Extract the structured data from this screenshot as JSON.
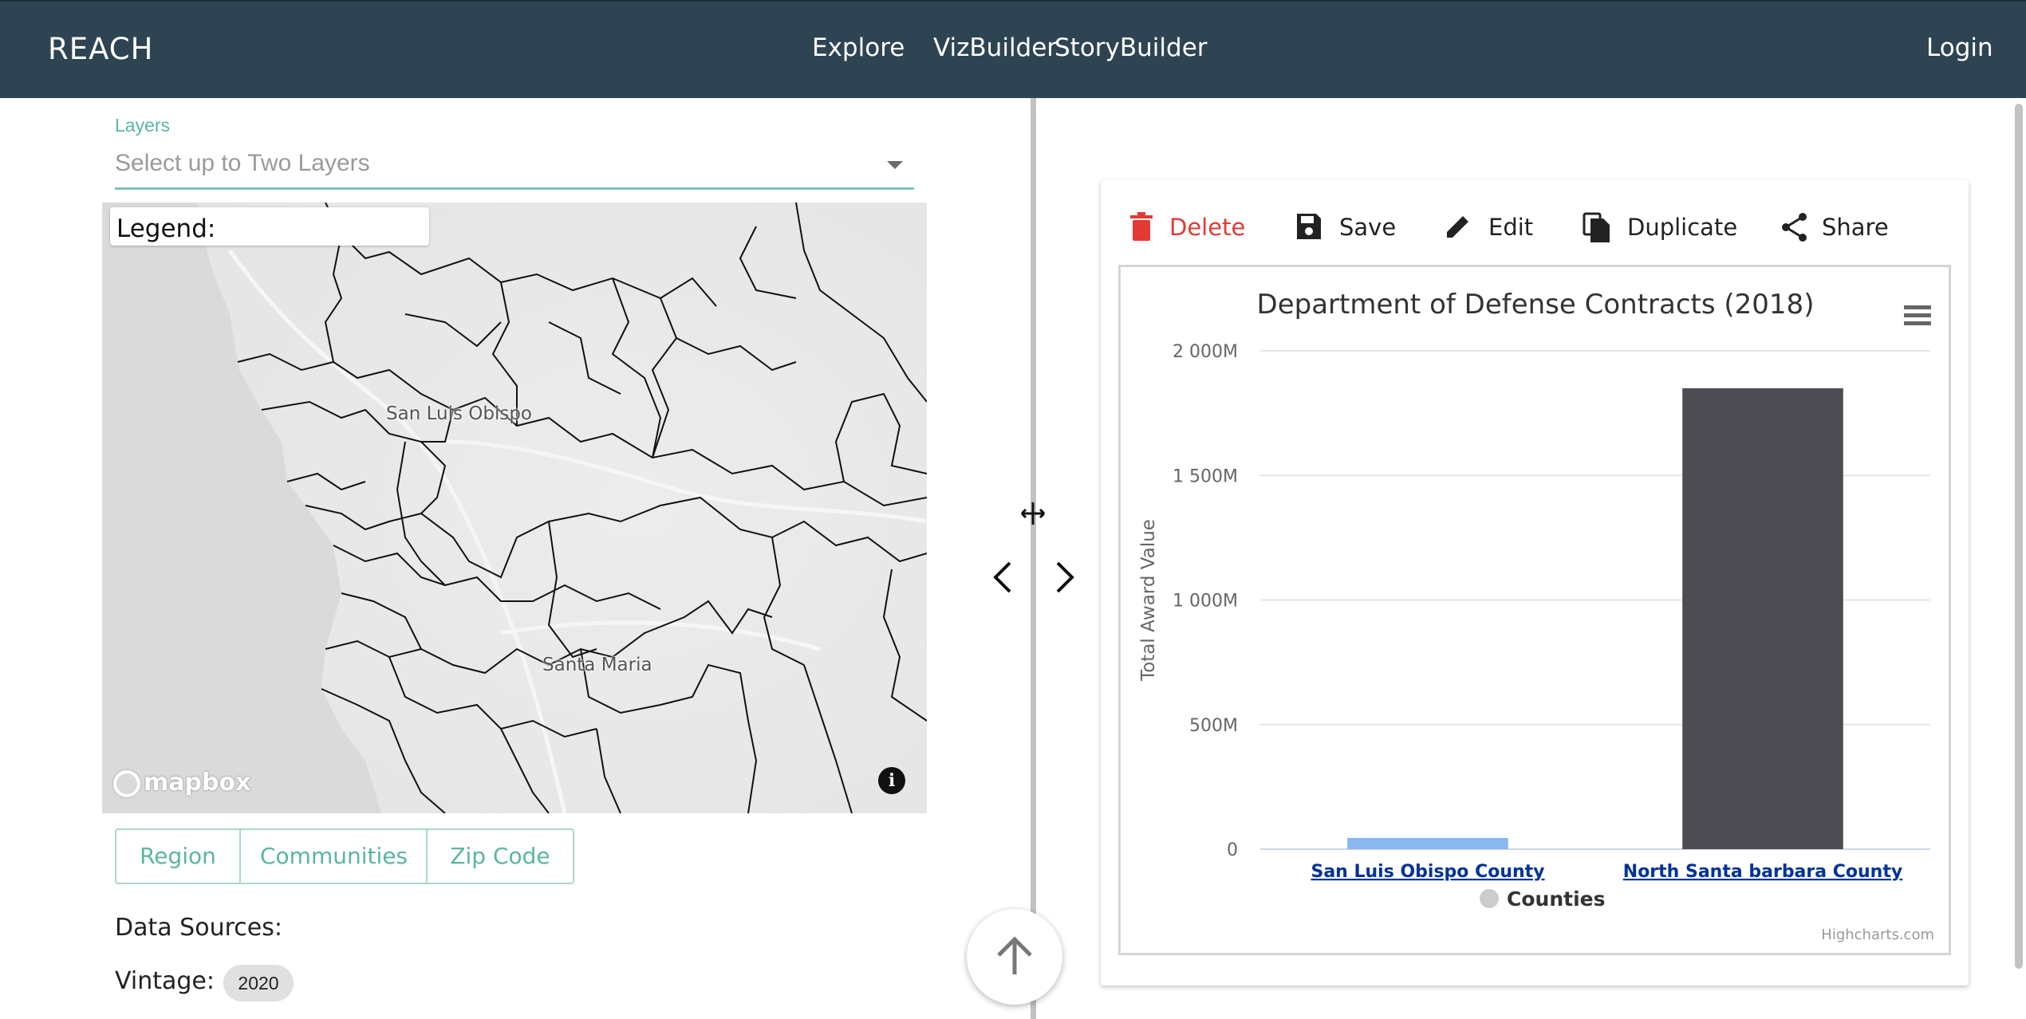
{
  "header": {
    "logo": "REACH",
    "nav": {
      "explore": "Explore",
      "vizbuilder": "VizBuilder",
      "storybuilder": "StoryBuilder",
      "login": "Login"
    },
    "background_color": "#2e4453"
  },
  "left_panel": {
    "layers_label": "Layers",
    "layers_placeholder": "Select up to Two Layers",
    "map": {
      "legend_label": "Legend:",
      "places": [
        "San Luis Obispo",
        "Santa Maria"
      ],
      "attribution": "mapbox",
      "info_icon": "info-icon"
    },
    "tabs": [
      "Region",
      "Communities",
      "Zip Code"
    ],
    "data_sources_label": "Data Sources:",
    "vintage_label": "Vintage:",
    "vintage_value": "2020",
    "accent_color": "#5bb5a2"
  },
  "toolbar": {
    "delete": "Delete",
    "save": "Save",
    "edit": "Edit",
    "duplicate": "Duplicate",
    "share": "Share",
    "delete_color": "#e53935"
  },
  "chart_data": {
    "type": "bar",
    "title": "Department of Defense Contracts (2018)",
    "ylabel": "Total Award Value",
    "xlabel": "",
    "categories": [
      "San Luis Obispo County",
      "North Santa barbara County"
    ],
    "series": [
      {
        "name": "Counties",
        "values": [
          45000000,
          1850000000
        ],
        "colors": [
          "#8ab8ee",
          "#4d4c52"
        ]
      }
    ],
    "ylim": [
      0,
      2000000000
    ],
    "yticks": [
      0,
      500000000,
      1000000000,
      1500000000,
      2000000000
    ],
    "ytick_labels": [
      "0",
      "500M",
      "1 000M",
      "1 500M",
      "2 000M"
    ],
    "legend": {
      "label": "Counties",
      "placement": "bottom-center"
    },
    "credits": "Highcharts.com",
    "grid": true
  }
}
